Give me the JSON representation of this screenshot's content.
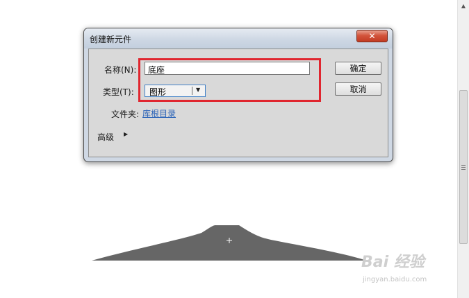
{
  "dialog": {
    "title": "创建新元件",
    "close_icon": "close-icon",
    "name_label": "名称(N):",
    "name_value": "底座",
    "type_label": "类型(T):",
    "type_value": "图形",
    "folder_label": "文件夹:",
    "folder_link": "库根目录",
    "advanced_label": "高级",
    "ok_label": "确定",
    "cancel_label": "取消"
  },
  "watermark": {
    "brand": "Bai 经验",
    "url": "jingyan.baidu.com"
  },
  "colors": {
    "highlight": "#e0262f",
    "shape_fill": "#666666",
    "link": "#2a63b8",
    "close_button": "#c23b22"
  }
}
